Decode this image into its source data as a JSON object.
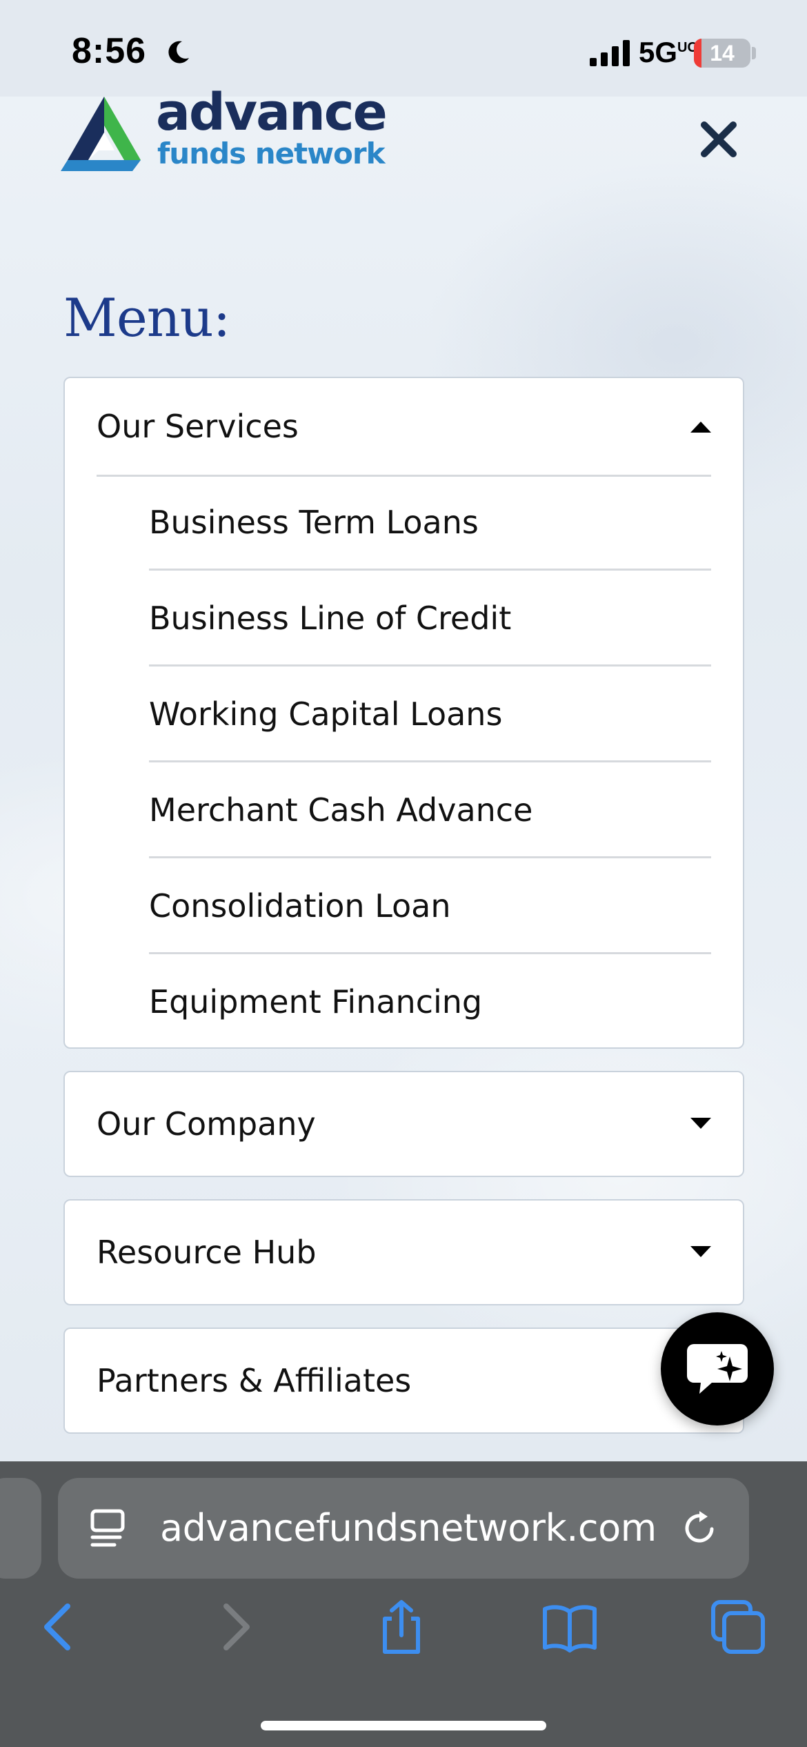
{
  "status_bar": {
    "time": "8:56",
    "network": "5G",
    "network_suffix": "UC",
    "battery": "14",
    "battery_level": 0.14
  },
  "header": {
    "logo_word": "advance",
    "logo_sub": "funds network"
  },
  "menu": {
    "title": "Menu:",
    "sections": [
      {
        "label": "Our Services",
        "expanded": true,
        "items": [
          "Business Term Loans",
          "Business Line of Credit",
          "Working Capital Loans",
          "Merchant Cash Advance",
          "Consolidation Loan",
          "Equipment Financing"
        ]
      },
      {
        "label": "Our Company",
        "expanded": false
      },
      {
        "label": "Resource Hub",
        "expanded": false
      },
      {
        "label": "Partners & Affiliates",
        "expanded": false
      }
    ]
  },
  "browser": {
    "url": "advancefundsnetwork.com"
  },
  "colors": {
    "menu_title": "#1c3a8a",
    "logo_dark": "#1a2e5c",
    "logo_light": "#2a86c8",
    "toolbar_icon": "#3d8ef0",
    "toolbar_icon_disabled": "#7a7d80"
  }
}
